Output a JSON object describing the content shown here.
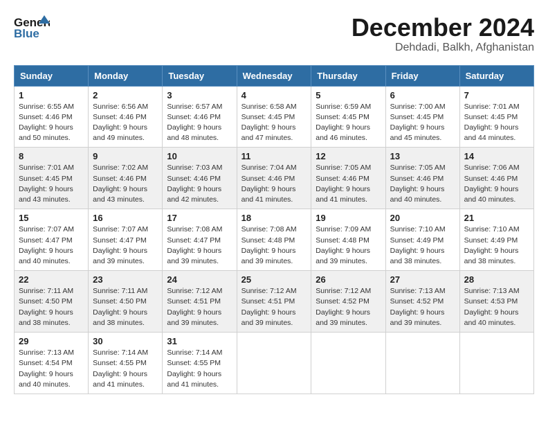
{
  "header": {
    "logo_text_general": "General",
    "logo_text_blue": "Blue",
    "month_year": "December 2024",
    "location": "Dehdadi, Balkh, Afghanistan"
  },
  "weekdays": [
    "Sunday",
    "Monday",
    "Tuesday",
    "Wednesday",
    "Thursday",
    "Friday",
    "Saturday"
  ],
  "weeks": [
    [
      {
        "day": "1",
        "sunrise": "6:55 AM",
        "sunset": "4:46 PM",
        "daylight": "9 hours and 50 minutes."
      },
      {
        "day": "2",
        "sunrise": "6:56 AM",
        "sunset": "4:46 PM",
        "daylight": "9 hours and 49 minutes."
      },
      {
        "day": "3",
        "sunrise": "6:57 AM",
        "sunset": "4:46 PM",
        "daylight": "9 hours and 48 minutes."
      },
      {
        "day": "4",
        "sunrise": "6:58 AM",
        "sunset": "4:45 PM",
        "daylight": "9 hours and 47 minutes."
      },
      {
        "day": "5",
        "sunrise": "6:59 AM",
        "sunset": "4:45 PM",
        "daylight": "9 hours and 46 minutes."
      },
      {
        "day": "6",
        "sunrise": "7:00 AM",
        "sunset": "4:45 PM",
        "daylight": "9 hours and 45 minutes."
      },
      {
        "day": "7",
        "sunrise": "7:01 AM",
        "sunset": "4:45 PM",
        "daylight": "9 hours and 44 minutes."
      }
    ],
    [
      {
        "day": "8",
        "sunrise": "7:01 AM",
        "sunset": "4:45 PM",
        "daylight": "9 hours and 43 minutes."
      },
      {
        "day": "9",
        "sunrise": "7:02 AM",
        "sunset": "4:46 PM",
        "daylight": "9 hours and 43 minutes."
      },
      {
        "day": "10",
        "sunrise": "7:03 AM",
        "sunset": "4:46 PM",
        "daylight": "9 hours and 42 minutes."
      },
      {
        "day": "11",
        "sunrise": "7:04 AM",
        "sunset": "4:46 PM",
        "daylight": "9 hours and 41 minutes."
      },
      {
        "day": "12",
        "sunrise": "7:05 AM",
        "sunset": "4:46 PM",
        "daylight": "9 hours and 41 minutes."
      },
      {
        "day": "13",
        "sunrise": "7:05 AM",
        "sunset": "4:46 PM",
        "daylight": "9 hours and 40 minutes."
      },
      {
        "day": "14",
        "sunrise": "7:06 AM",
        "sunset": "4:46 PM",
        "daylight": "9 hours and 40 minutes."
      }
    ],
    [
      {
        "day": "15",
        "sunrise": "7:07 AM",
        "sunset": "4:47 PM",
        "daylight": "9 hours and 40 minutes."
      },
      {
        "day": "16",
        "sunrise": "7:07 AM",
        "sunset": "4:47 PM",
        "daylight": "9 hours and 39 minutes."
      },
      {
        "day": "17",
        "sunrise": "7:08 AM",
        "sunset": "4:47 PM",
        "daylight": "9 hours and 39 minutes."
      },
      {
        "day": "18",
        "sunrise": "7:08 AM",
        "sunset": "4:48 PM",
        "daylight": "9 hours and 39 minutes."
      },
      {
        "day": "19",
        "sunrise": "7:09 AM",
        "sunset": "4:48 PM",
        "daylight": "9 hours and 39 minutes."
      },
      {
        "day": "20",
        "sunrise": "7:10 AM",
        "sunset": "4:49 PM",
        "daylight": "9 hours and 38 minutes."
      },
      {
        "day": "21",
        "sunrise": "7:10 AM",
        "sunset": "4:49 PM",
        "daylight": "9 hours and 38 minutes."
      }
    ],
    [
      {
        "day": "22",
        "sunrise": "7:11 AM",
        "sunset": "4:50 PM",
        "daylight": "9 hours and 38 minutes."
      },
      {
        "day": "23",
        "sunrise": "7:11 AM",
        "sunset": "4:50 PM",
        "daylight": "9 hours and 38 minutes."
      },
      {
        "day": "24",
        "sunrise": "7:12 AM",
        "sunset": "4:51 PM",
        "daylight": "9 hours and 39 minutes."
      },
      {
        "day": "25",
        "sunrise": "7:12 AM",
        "sunset": "4:51 PM",
        "daylight": "9 hours and 39 minutes."
      },
      {
        "day": "26",
        "sunrise": "7:12 AM",
        "sunset": "4:52 PM",
        "daylight": "9 hours and 39 minutes."
      },
      {
        "day": "27",
        "sunrise": "7:13 AM",
        "sunset": "4:52 PM",
        "daylight": "9 hours and 39 minutes."
      },
      {
        "day": "28",
        "sunrise": "7:13 AM",
        "sunset": "4:53 PM",
        "daylight": "9 hours and 40 minutes."
      }
    ],
    [
      {
        "day": "29",
        "sunrise": "7:13 AM",
        "sunset": "4:54 PM",
        "daylight": "9 hours and 40 minutes."
      },
      {
        "day": "30",
        "sunrise": "7:14 AM",
        "sunset": "4:55 PM",
        "daylight": "9 hours and 41 minutes."
      },
      {
        "day": "31",
        "sunrise": "7:14 AM",
        "sunset": "4:55 PM",
        "daylight": "9 hours and 41 minutes."
      },
      null,
      null,
      null,
      null
    ]
  ],
  "labels": {
    "sunrise": "Sunrise:",
    "sunset": "Sunset:",
    "daylight": "Daylight:"
  }
}
